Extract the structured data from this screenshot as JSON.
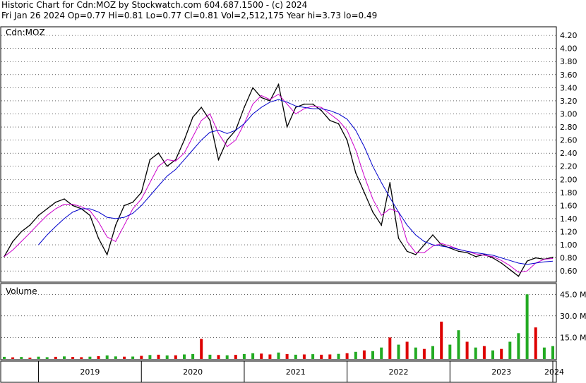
{
  "header": {
    "title": "Historic Chart for Cdn:MOZ by Stockwatch.com 604.687.1500 - (c) 2024",
    "quote": "Fri Jan 26 2024   Op=0.77  Hi=0.81  Lo=0.77  Cl=0.81  Vol=2,512,175  Year hi=3.73  lo=0.49"
  },
  "colors": {
    "price": "#000000",
    "ma_short": "#cc00cc",
    "ma_long": "#0000cc",
    "grid": "#000000",
    "vol_up": "#22aa22",
    "vol_down": "#dd0000"
  },
  "chart_data": [
    {
      "type": "line",
      "panel": "price",
      "label": "Cdn:MOZ",
      "grid": true,
      "ylim": [
        0.44,
        4.32
      ],
      "yticks": [
        "4.20",
        "4.00",
        "3.80",
        "3.60",
        "3.40",
        "3.20",
        "3.00",
        "2.80",
        "2.60",
        "2.40",
        "2.20",
        "2.00",
        "1.80",
        "1.60",
        "1.40",
        "1.20",
        "1.00",
        "0.80",
        "0.60"
      ],
      "x_axis_labels": [
        "2019",
        "2020",
        "2021",
        "2022",
        "2023",
        "2024"
      ],
      "x": [
        "2018-09",
        "2018-10",
        "2018-11",
        "2018-12",
        "2019-01",
        "2019-02",
        "2019-03",
        "2019-04",
        "2019-05",
        "2019-06",
        "2019-07",
        "2019-08",
        "2019-09",
        "2019-10",
        "2019-11",
        "2019-12",
        "2020-01",
        "2020-02",
        "2020-03",
        "2020-04",
        "2020-05",
        "2020-06",
        "2020-07",
        "2020-08",
        "2020-09",
        "2020-10",
        "2020-11",
        "2020-12",
        "2021-01",
        "2021-02",
        "2021-03",
        "2021-04",
        "2021-05",
        "2021-06",
        "2021-07",
        "2021-08",
        "2021-09",
        "2021-10",
        "2021-11",
        "2021-12",
        "2022-01",
        "2022-02",
        "2022-03",
        "2022-04",
        "2022-05",
        "2022-06",
        "2022-07",
        "2022-08",
        "2022-09",
        "2022-10",
        "2022-11",
        "2022-12",
        "2023-01",
        "2023-02",
        "2023-03",
        "2023-04",
        "2023-05",
        "2023-06",
        "2023-07",
        "2023-08",
        "2023-09",
        "2023-10",
        "2023-11",
        "2023-12",
        "2024-01"
      ],
      "series": [
        {
          "name": "",
          "key": "price",
          "values": [
            0.82,
            1.05,
            1.2,
            1.3,
            1.45,
            1.55,
            1.65,
            1.7,
            1.6,
            1.55,
            1.45,
            1.1,
            0.85,
            1.3,
            1.6,
            1.65,
            1.8,
            2.3,
            2.4,
            2.2,
            2.3,
            2.6,
            2.95,
            3.1,
            2.9,
            2.3,
            2.6,
            2.75,
            3.1,
            3.4,
            3.25,
            3.2,
            3.45,
            2.8,
            3.1,
            3.15,
            3.15,
            3.05,
            2.9,
            2.85,
            2.6,
            2.1,
            1.8,
            1.5,
            1.3,
            1.95,
            1.1,
            0.9,
            0.85,
            1.0,
            1.15,
            1.0,
            0.95,
            0.9,
            0.88,
            0.82,
            0.85,
            0.8,
            0.72,
            0.62,
            0.52,
            0.75,
            0.8,
            0.78,
            0.81
          ]
        },
        {
          "name": "",
          "key": "ma_short",
          "values": [
            0.82,
            0.92,
            1.05,
            1.18,
            1.32,
            1.45,
            1.55,
            1.62,
            1.62,
            1.58,
            1.52,
            1.35,
            1.12,
            1.05,
            1.3,
            1.55,
            1.7,
            1.95,
            2.2,
            2.3,
            2.28,
            2.4,
            2.65,
            2.9,
            3.0,
            2.7,
            2.5,
            2.6,
            2.85,
            3.15,
            3.28,
            3.22,
            3.3,
            3.15,
            3.0,
            3.08,
            3.12,
            3.1,
            3.0,
            2.9,
            2.75,
            2.45,
            2.05,
            1.7,
            1.45,
            1.55,
            1.5,
            1.05,
            0.88,
            0.88,
            0.98,
            1.02,
            0.98,
            0.93,
            0.9,
            0.86,
            0.84,
            0.82,
            0.76,
            0.68,
            0.58,
            0.6,
            0.72,
            0.78,
            0.79
          ]
        },
        {
          "name": "",
          "key": "ma_long",
          "values": [
            null,
            null,
            null,
            null,
            1.0,
            1.15,
            1.28,
            1.4,
            1.5,
            1.55,
            1.55,
            1.5,
            1.42,
            1.4,
            1.42,
            1.48,
            1.6,
            1.75,
            1.9,
            2.05,
            2.15,
            2.3,
            2.45,
            2.6,
            2.72,
            2.75,
            2.7,
            2.75,
            2.85,
            3.0,
            3.1,
            3.18,
            3.22,
            3.18,
            3.12,
            3.1,
            3.08,
            3.08,
            3.05,
            3.0,
            2.92,
            2.75,
            2.5,
            2.2,
            1.95,
            1.72,
            1.5,
            1.3,
            1.15,
            1.05,
            1.0,
            0.98,
            0.96,
            0.93,
            0.9,
            0.88,
            0.86,
            0.84,
            0.8,
            0.76,
            0.72,
            0.7,
            0.72,
            0.74,
            0.75
          ]
        }
      ]
    },
    {
      "type": "bar",
      "panel": "volume",
      "label": "Volume",
      "ylim": [
        0,
        52
      ],
      "yticks": [
        "45.0 M",
        "30.0 M",
        "15.0 M"
      ],
      "x": [
        "2018-09",
        "2018-10",
        "2018-11",
        "2018-12",
        "2019-01",
        "2019-02",
        "2019-03",
        "2019-04",
        "2019-05",
        "2019-06",
        "2019-07",
        "2019-08",
        "2019-09",
        "2019-10",
        "2019-11",
        "2019-12",
        "2020-01",
        "2020-02",
        "2020-03",
        "2020-04",
        "2020-05",
        "2020-06",
        "2020-07",
        "2020-08",
        "2020-09",
        "2020-10",
        "2020-11",
        "2020-12",
        "2021-01",
        "2021-02",
        "2021-03",
        "2021-04",
        "2021-05",
        "2021-06",
        "2021-07",
        "2021-08",
        "2021-09",
        "2021-10",
        "2021-11",
        "2021-12",
        "2022-01",
        "2022-02",
        "2022-03",
        "2022-04",
        "2022-05",
        "2022-06",
        "2022-07",
        "2022-08",
        "2022-09",
        "2022-10",
        "2022-11",
        "2022-12",
        "2023-01",
        "2023-02",
        "2023-03",
        "2023-04",
        "2023-05",
        "2023-06",
        "2023-07",
        "2023-08",
        "2023-09",
        "2023-10",
        "2023-11",
        "2023-12",
        "2024-01"
      ],
      "values": [
        1.5,
        1.2,
        1.4,
        1.0,
        1.6,
        1.3,
        1.5,
        1.8,
        1.4,
        1.3,
        1.6,
        2.0,
        2.5,
        1.8,
        1.6,
        1.7,
        2.2,
        2.8,
        3.0,
        2.5,
        2.6,
        3.2,
        3.5,
        14.0,
        3.0,
        2.8,
        2.6,
        2.9,
        3.5,
        4.0,
        3.8,
        3.2,
        4.5,
        3.5,
        3.0,
        3.2,
        3.4,
        3.0,
        3.2,
        3.6,
        4.0,
        5.0,
        6.0,
        5.5,
        8.0,
        15.0,
        10.0,
        12.0,
        8.0,
        7.0,
        9.0,
        26.0,
        10.0,
        20.0,
        12.0,
        8.0,
        9.0,
        6.0,
        7.0,
        12.0,
        18.0,
        45.0,
        22.0,
        8.0,
        9.0
      ],
      "up": [
        true,
        false,
        true,
        false,
        true,
        true,
        false,
        true,
        false,
        false,
        true,
        false,
        true,
        true,
        false,
        true,
        false,
        true,
        false,
        true,
        false,
        true,
        true,
        false,
        true,
        false,
        true,
        false,
        true,
        true,
        false,
        false,
        true,
        false,
        true,
        false,
        true,
        false,
        false,
        true,
        false,
        true,
        false,
        true,
        true,
        false,
        true,
        false,
        true,
        false,
        true,
        false,
        true,
        true,
        false,
        true,
        false,
        true,
        false,
        true,
        true,
        true,
        false,
        true,
        true
      ]
    }
  ]
}
